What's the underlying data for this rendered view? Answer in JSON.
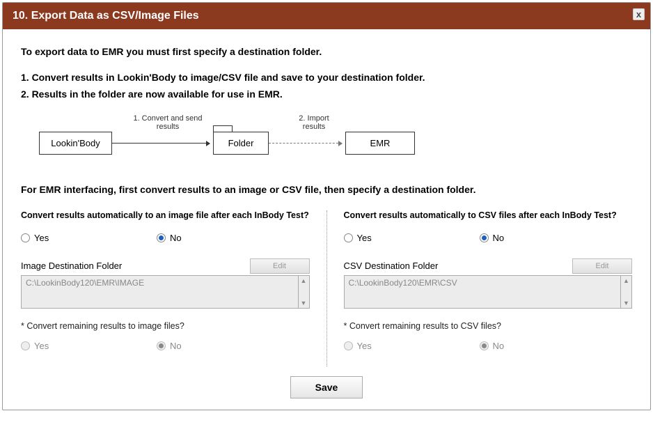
{
  "title": "10. Export Data as CSV/Image Files",
  "close_label": "x",
  "intro": "To export data to EMR you must first specify a destination folder.",
  "step1": "1. Convert results in Lookin'Body to image/CSV file and save to your destination folder.",
  "step2": "2. Results in the folder are now available for use in EMR.",
  "diagram": {
    "lookinbody": "Lookin'Body",
    "folder": "Folder",
    "emr": "EMR",
    "label1": "1. Convert and send results",
    "label2": "2. Import results"
  },
  "subintro": "For EMR interfacing, first convert results to an image or CSV file, then specify a destination folder.",
  "yes": "Yes",
  "no": "No",
  "left": {
    "question": "Convert results automatically to an image file after each InBody Test?",
    "selected": "no",
    "dest_label": "Image Destination Folder",
    "edit": "Edit",
    "path": "C:\\LookinBody120\\EMR\\IMAGE",
    "remaining_q": "* Convert remaining results to image files?",
    "remaining_selected": "no"
  },
  "right": {
    "question": "Convert results automatically to CSV files after each InBody Test?",
    "selected": "no",
    "dest_label": "CSV Destination Folder",
    "edit": "Edit",
    "path": "C:\\LookinBody120\\EMR\\CSV",
    "remaining_q": "* Convert remaining results to CSV files?",
    "remaining_selected": "no"
  },
  "save": "Save"
}
